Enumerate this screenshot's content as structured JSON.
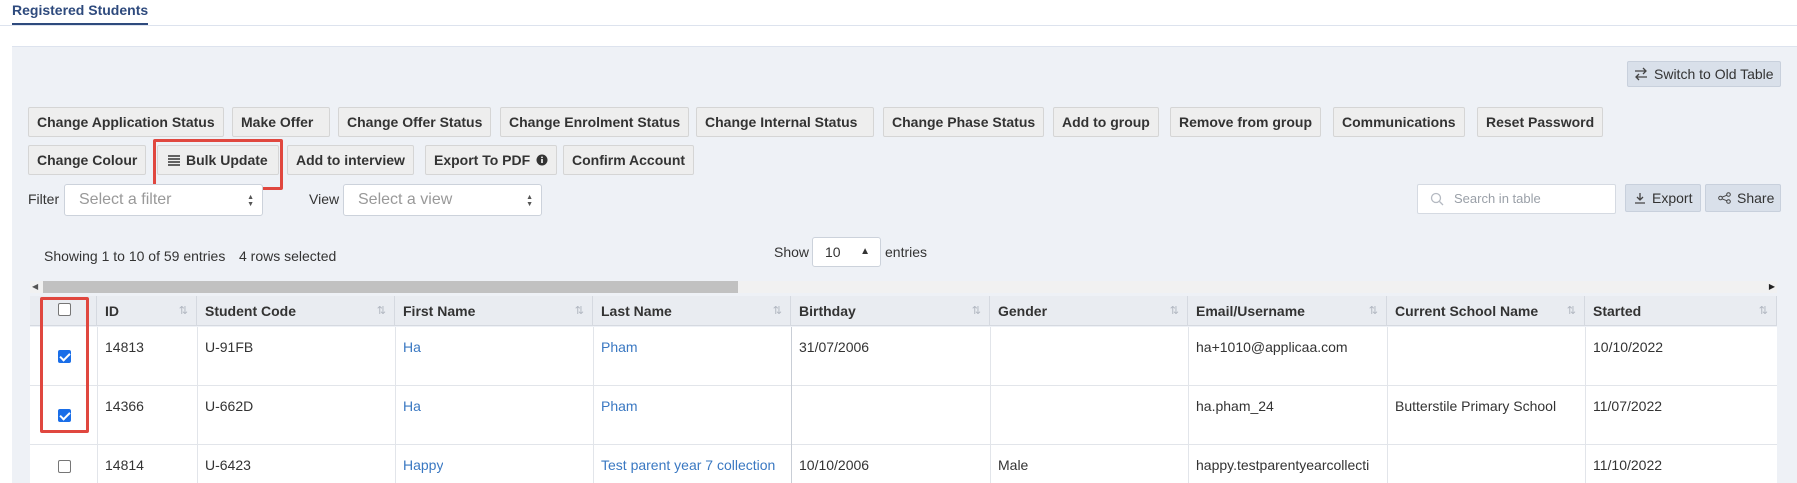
{
  "tabs": [
    {
      "label": "Registered Students",
      "active": true
    }
  ],
  "switch_button": {
    "label": "Switch to Old Table",
    "icon": "swap-arrows-icon"
  },
  "toolbar_row1": [
    "Change Application Status",
    "Make Offer",
    "Change Offer Status",
    "Change Enrolment Status",
    "Change Internal Status",
    "Change Phase Status",
    "Add to group",
    "Remove from group",
    "Communications",
    "Reset Password"
  ],
  "toolbar_row2": {
    "change_colour": "Change Colour",
    "bulk_update": "Bulk Update",
    "add_to_interview": "Add to interview",
    "export_pdf": "Export To PDF",
    "confirm_account": "Confirm Account"
  },
  "filter": {
    "label": "Filter",
    "placeholder": "Select a filter"
  },
  "view": {
    "label": "View",
    "placeholder": "Select a view"
  },
  "search": {
    "placeholder": "Search in table"
  },
  "export_button": {
    "label": "Export"
  },
  "share_button": {
    "label": "Share"
  },
  "info": {
    "showing": "Showing 1 to 10 of 59 entries",
    "selected": "4 rows selected"
  },
  "page_length": {
    "prefix": "Show",
    "value": "10",
    "suffix": "entries"
  },
  "columns": [
    "ID",
    "Student Code",
    "First Name",
    "Last Name",
    "Birthday",
    "Gender",
    "Email/Username",
    "Current School Name",
    "Started"
  ],
  "rows": [
    {
      "checked": true,
      "id": "14813",
      "code": "U-91FB",
      "first": "Ha",
      "last": "Pham",
      "birthday": "31/07/2006",
      "gender": "",
      "email": "ha+1010@applicaa.com",
      "school": "",
      "started": "10/10/2022"
    },
    {
      "checked": true,
      "id": "14366",
      "code": "U-662D",
      "first": "Ha",
      "last": "Pham",
      "birthday": "",
      "gender": "",
      "email": "ha.pham_24",
      "school": "Butterstile Primary School",
      "started": "11/07/2022"
    },
    {
      "checked": false,
      "id": "14814",
      "code": "U-6423",
      "first": "Happy",
      "last": "Test parent year 7 collection",
      "birthday": "10/10/2006",
      "gender": "Male",
      "email": "happy.testparentyearcollecti",
      "school": "",
      "started": "11/10/2022"
    }
  ],
  "colors": {
    "accent": "#2e4a7d",
    "link": "#3a78c2",
    "highlight": "#e0473f",
    "checkbox": "#1a6ee8"
  }
}
